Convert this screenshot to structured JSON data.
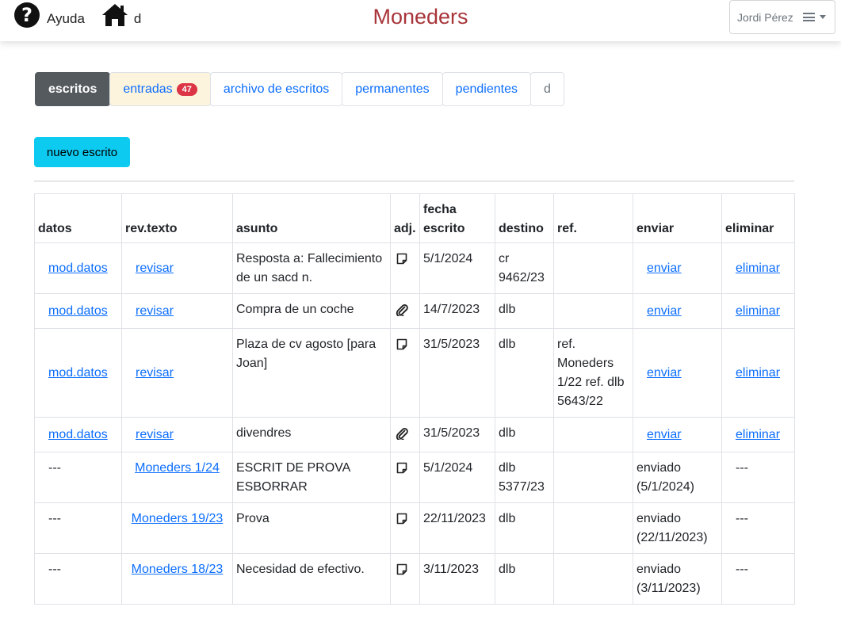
{
  "header": {
    "help_label": "Ayuda",
    "home_label": "d",
    "app_title": "Moneders",
    "user_name": "Jordi Pérez",
    "help_icon": "question-circle-icon",
    "home_icon": "home-icon",
    "menu_icon": "hamburger-icon"
  },
  "tabs": [
    {
      "label": "escritos",
      "state": "active"
    },
    {
      "label": "entradas",
      "badge": "47",
      "state": "highlight"
    },
    {
      "label": "archivo de escritos"
    },
    {
      "label": "permanentes"
    },
    {
      "label": "pendientes"
    },
    {
      "label": "d",
      "state": "muted"
    }
  ],
  "new_button_label": "nuevo escrito",
  "table": {
    "headers": {
      "datos": "datos",
      "revtexto": "rev.texto",
      "asunto": "asunto",
      "adj": "adj.",
      "fecha_line1": "fecha",
      "fecha_line2": "escrito",
      "destino": "destino",
      "ref": "ref.",
      "enviar": "enviar",
      "eliminar": "eliminar"
    },
    "rows": [
      {
        "datos": "mod.datos",
        "rev": "revisar",
        "asunto": "Resposta a: Fallecimiento de un sacd n.",
        "adj": "note",
        "fecha": "5/1/2024",
        "destino": "cr 9462/23",
        "ref": "",
        "enviar": "enviar",
        "eliminar": "eliminar"
      },
      {
        "datos": "mod.datos",
        "rev": "revisar",
        "asunto": "Compra de un coche",
        "adj": "clip",
        "fecha": "14/7/2023",
        "destino": "dlb",
        "ref": "",
        "enviar": "enviar",
        "eliminar": "eliminar"
      },
      {
        "datos": "mod.datos",
        "rev": "revisar",
        "asunto": "Plaza de cv agosto [para Joan]",
        "adj": "note",
        "fecha": "31/5/2023",
        "destino": "dlb",
        "ref": "ref. Moneders 1/22 ref. dlb 5643/22",
        "enviar": "enviar",
        "eliminar": "eliminar"
      },
      {
        "datos": "mod.datos",
        "rev": "revisar",
        "asunto": "divendres",
        "adj": "clip",
        "fecha": "31/5/2023",
        "destino": "dlb",
        "ref": "",
        "enviar": "enviar",
        "eliminar": "eliminar"
      },
      {
        "datos": "---",
        "rev": "Moneders 1/24",
        "asunto": "ESCRIT DE PROVA ESBORRAR",
        "adj": "note",
        "fecha": "5/1/2024",
        "destino": "dlb 5377/23",
        "ref": "",
        "enviar": "enviado (5/1/2024)",
        "eliminar": "---"
      },
      {
        "datos": "---",
        "rev": "Moneders 19/23",
        "asunto": "Prova",
        "adj": "note",
        "fecha": "22/11/2023",
        "destino": "dlb",
        "ref": "",
        "enviar": "enviado (22/11/2023)",
        "eliminar": "---"
      },
      {
        "datos": "---",
        "rev": "Moneders 18/23",
        "asunto": "Necesidad de efectivo.",
        "adj": "note",
        "fecha": "3/11/2023",
        "destino": "dlb",
        "ref": "",
        "enviar": "enviado (3/11/2023)",
        "eliminar": "---"
      }
    ]
  }
}
